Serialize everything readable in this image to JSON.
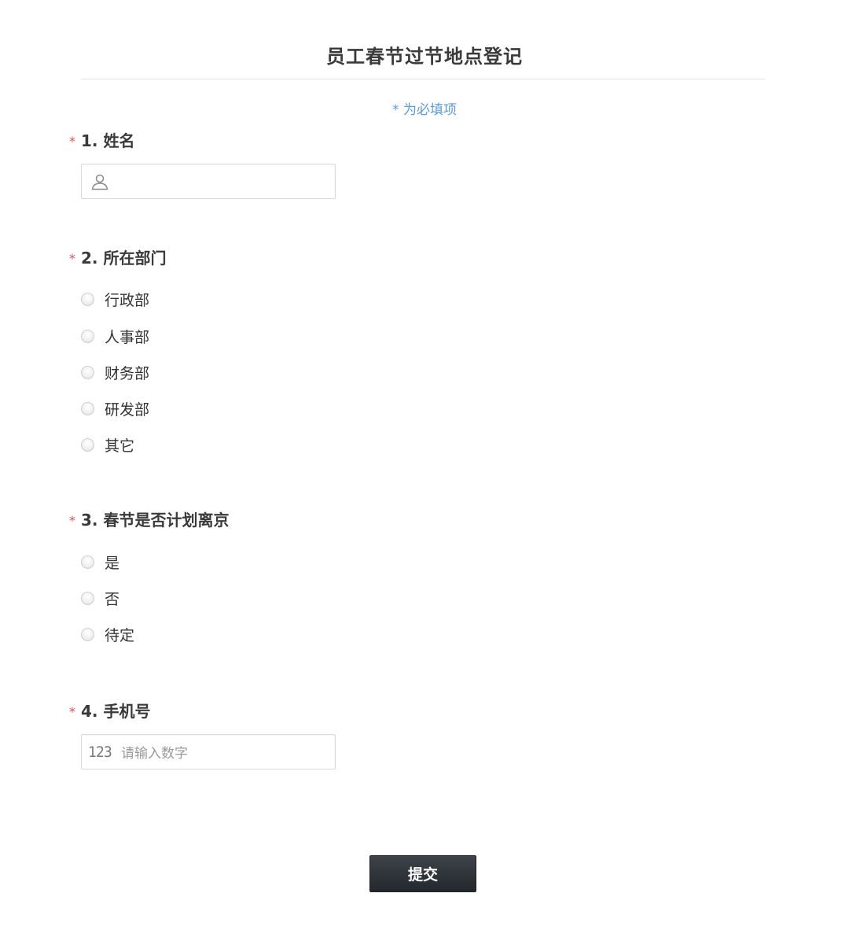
{
  "form": {
    "title": "员工春节过节地点登记",
    "required_note": "* 为必填项",
    "submit_label": "提交"
  },
  "questions": [
    {
      "star": "*",
      "label": "1. 姓名",
      "type": "text",
      "icon": "user-icon",
      "placeholder": ""
    },
    {
      "star": "*",
      "label": "2. 所在部门",
      "type": "radio",
      "options": [
        "行政部",
        "人事部",
        "财务部",
        "研发部",
        "其它"
      ]
    },
    {
      "star": "*",
      "label": "3. 春节是否计划离京",
      "type": "radio",
      "options": [
        "是",
        "否",
        "待定"
      ]
    },
    {
      "star": "*",
      "label": "4. 手机号",
      "type": "number",
      "icon_text": "123",
      "placeholder": "请输入数字"
    }
  ],
  "colors": {
    "required_star": "#e04f4f",
    "required_note": "#5b9bd5",
    "submit_bg": "#2f3338"
  }
}
